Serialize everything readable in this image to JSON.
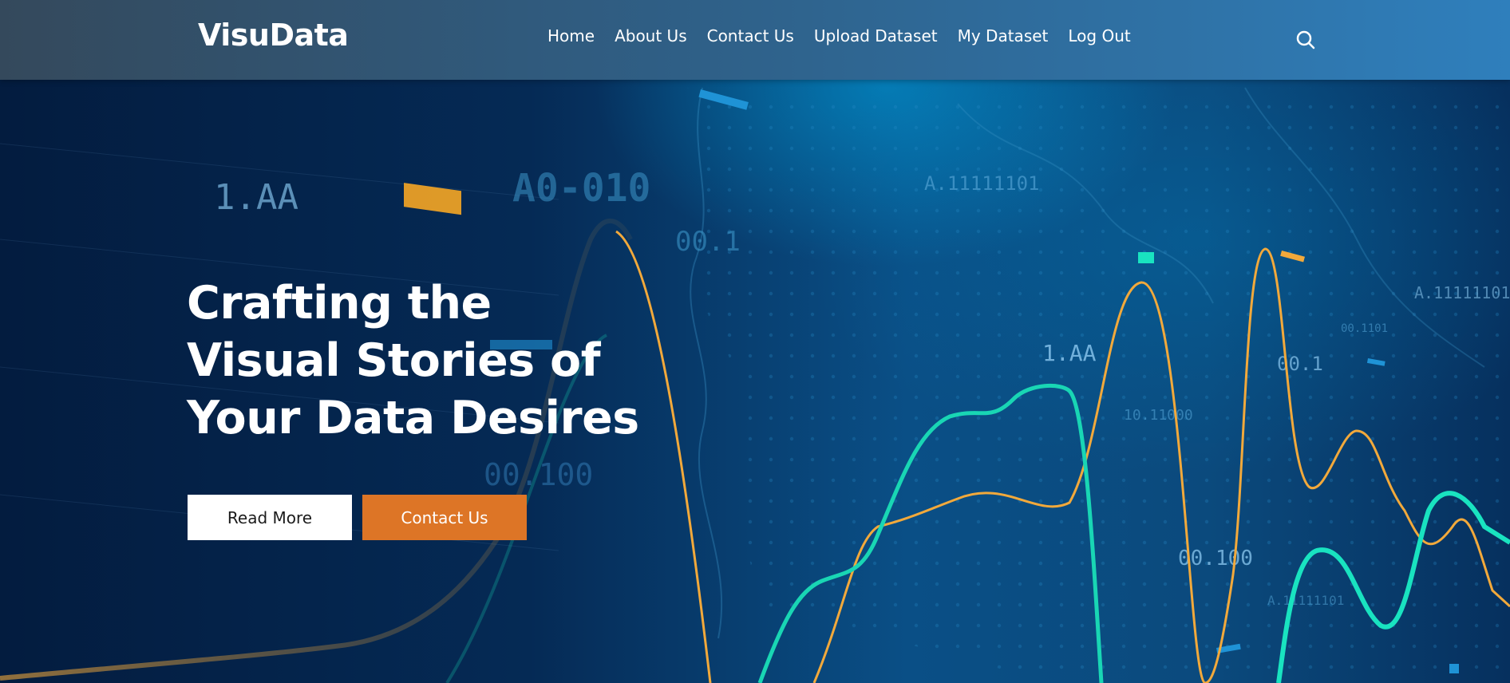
{
  "brand": {
    "logo": "VisuData"
  },
  "nav": {
    "items": [
      "Home",
      "About Us",
      "Contact Us",
      "Upload Dataset",
      "My Dataset",
      "Log Out"
    ]
  },
  "search": {
    "icon": "search-icon"
  },
  "hero": {
    "title_lines": [
      "Crafting the",
      "Visual Stories of",
      "Your Data Desires"
    ],
    "read_more": "Read More",
    "contact_us": "Contact Us"
  },
  "background_labels": [
    "1.AA",
    "A0-010",
    "00.1",
    "A.11111101",
    "1.AA",
    "00.1",
    "00.100",
    "00.100",
    "10.11000",
    "A.11111101",
    "00.1101",
    "A.11111101"
  ],
  "colors": {
    "accent_orange": "#dd7526",
    "line_orange": "#f2a93b",
    "line_teal": "#19d6b4",
    "nav_start": "#34495c",
    "nav_end": "#2f7fbc"
  }
}
